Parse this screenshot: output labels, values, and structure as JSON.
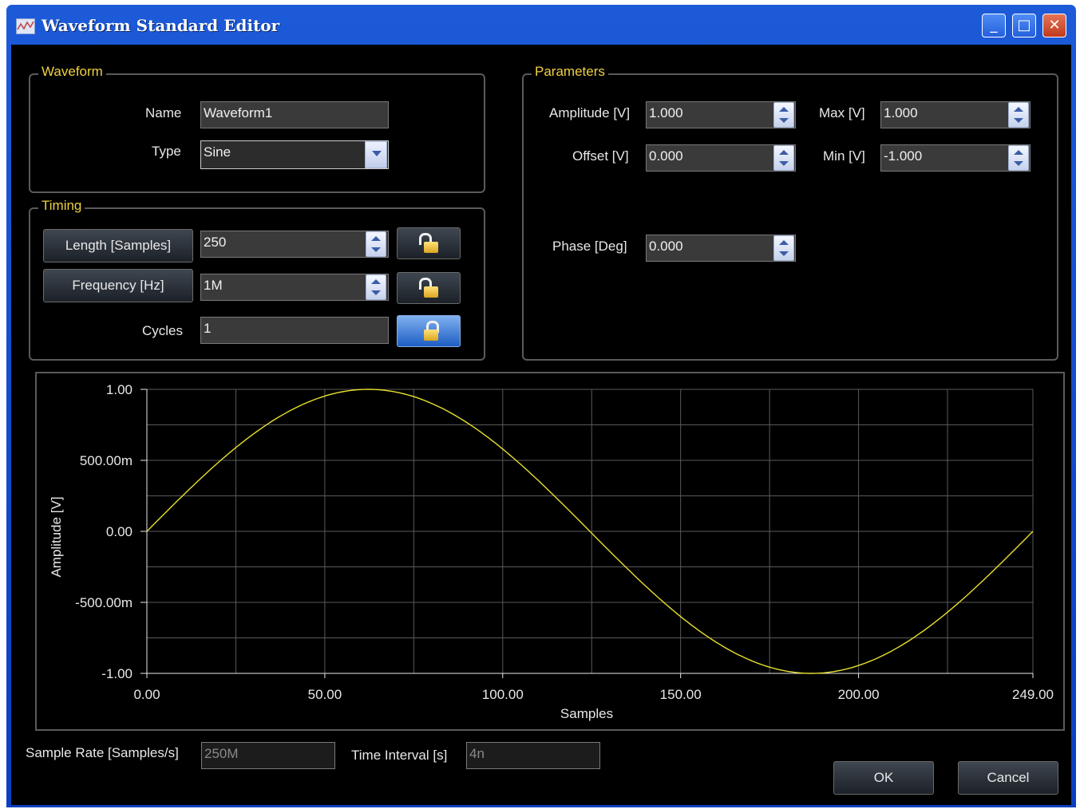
{
  "window": {
    "title": "Waveform Standard Editor",
    "minimize": "_",
    "maximize": "□",
    "close": "✕"
  },
  "waveform": {
    "legend": "Waveform",
    "name_label": "Name",
    "name_value": "Waveform1",
    "type_label": "Type",
    "type_value": "Sine"
  },
  "timing": {
    "legend": "Timing",
    "length_label": "Length [Samples]",
    "length_value": "250",
    "frequency_label": "Frequency [Hz]",
    "frequency_value": "1M",
    "cycles_label": "Cycles",
    "cycles_value": "1"
  },
  "parameters": {
    "legend": "Parameters",
    "amplitude_label": "Amplitude [V]",
    "amplitude_value": "1.000",
    "offset_label": "Offset [V]",
    "offset_value": "0.000",
    "max_label": "Max [V]",
    "max_value": "1.000",
    "min_label": "Min [V]",
    "min_value": "-1.000",
    "phase_label": "Phase [Deg]",
    "phase_value": "0.000"
  },
  "footer": {
    "sample_rate_label": "Sample Rate [Samples/s]",
    "sample_rate_value": "250M",
    "time_interval_label": "Time Interval [s]",
    "time_interval_value": "4n",
    "ok_label": "OK",
    "cancel_label": "Cancel"
  },
  "colors": {
    "trace": "#e8e030",
    "grid": "#5a5a5a",
    "legend_text": "#f0d040"
  },
  "chart_data": {
    "type": "line",
    "xlabel": "Samples",
    "ylabel": "Amplitude [V]",
    "xlim": [
      0,
      249
    ],
    "ylim": [
      -1,
      1
    ],
    "x_ticks": [
      0,
      50,
      100,
      150,
      200,
      249
    ],
    "x_tick_labels": [
      "0.00",
      "50.00",
      "100.00",
      "150.00",
      "200.00",
      "249.00"
    ],
    "y_ticks": [
      1,
      0.5,
      0,
      -0.5,
      -1
    ],
    "y_tick_labels": [
      "1.00",
      "500.00m",
      "0.00",
      "-500.00m",
      "-1.00"
    ],
    "grid": true,
    "series": [
      {
        "function": "sine",
        "amplitude": 1.0,
        "offset": 0.0,
        "phase_deg": 0.0,
        "length": 250,
        "cycles": 1
      }
    ]
  }
}
